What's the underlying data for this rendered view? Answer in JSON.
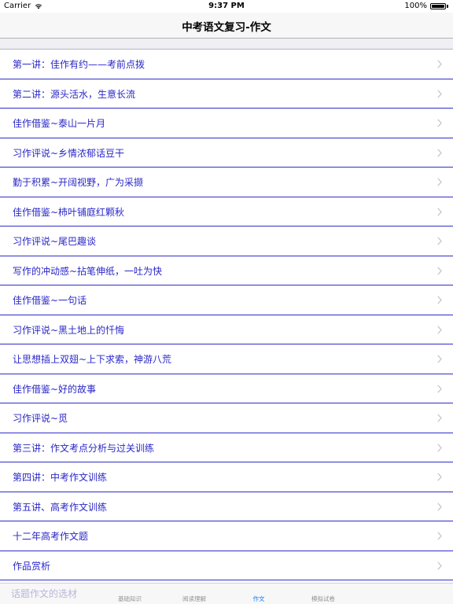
{
  "status_bar": {
    "carrier": "Carrier",
    "time": "9:37 PM",
    "battery": "100%"
  },
  "nav": {
    "title": "中考语文复习-作文"
  },
  "list": {
    "items": [
      {
        "label": "第一讲：佳作有约——考前点拨"
      },
      {
        "label": "第二讲：源头活水，生意长流"
      },
      {
        "label": "佳作借鉴~泰山一片月"
      },
      {
        "label": "习作评说~乡情浓郁话豆干"
      },
      {
        "label": "勤于积累~开阔视野，广为采撷"
      },
      {
        "label": "佳作借鉴~柿叶铺庭红颗秋"
      },
      {
        "label": "习作评说~尾巴趣谈"
      },
      {
        "label": "写作的冲动感~拈笔伸纸，一吐为快"
      },
      {
        "label": "佳作借鉴~一句话"
      },
      {
        "label": "习作评说~黑土地上的忏悔"
      },
      {
        "label": "让思想插上双翅~上下求索，神游八荒"
      },
      {
        "label": "佳作借鉴~好的故事"
      },
      {
        "label": "习作评说~觅"
      },
      {
        "label": "第三讲：作文考点分析与过关训练"
      },
      {
        "label": "第四讲：中考作文训练"
      },
      {
        "label": "第五讲、高考作文训练"
      },
      {
        "label": "十二年高考作文题"
      },
      {
        "label": "作品赏析"
      }
    ]
  },
  "tab_bar": {
    "ghost_text": "话题作文的选材",
    "tabs": [
      {
        "label": "基础知识",
        "active": false
      },
      {
        "label": "阅读理解",
        "active": false
      },
      {
        "label": "作文",
        "active": true
      },
      {
        "label": "模拟试卷",
        "active": false
      }
    ]
  },
  "colors": {
    "list_text": "#2a27c7",
    "separator": "#2e2ec8",
    "active_tab": "#1a7cf5",
    "inactive_tab": "#929292"
  },
  "icons": {
    "signal": "wifi-icon",
    "battery": "battery-icon",
    "disclosure": "chevron-right-icon"
  }
}
